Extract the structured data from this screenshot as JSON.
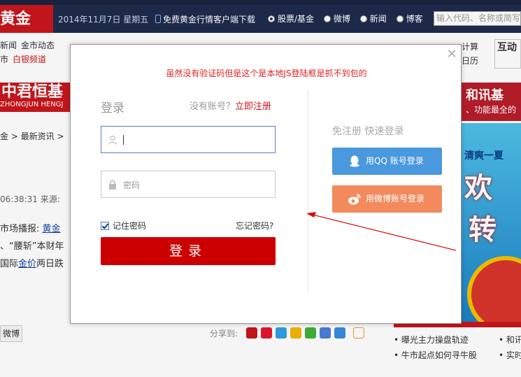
{
  "header": {
    "logo": "黄金",
    "date": "2014年11月7日  星期五",
    "download": "免费黄金行情客户端下载",
    "radios": [
      {
        "label": "股票/基金",
        "selected": true
      },
      {
        "label": "微博",
        "selected": false
      },
      {
        "label": "新闻",
        "selected": false
      },
      {
        "label": "博客",
        "selected": false
      }
    ],
    "search_placeholder": "输入代码、名称或简写"
  },
  "subnav": {
    "row1": [
      "新闻",
      "金市动态"
    ],
    "row2_a": "市",
    "row2_b": "白银频道",
    "right1": "计算",
    "right2": "日历",
    "hudong": "互动"
  },
  "banner_left": {
    "big": "中君恒基",
    "small": "ZHONGJUN HENGJ"
  },
  "banner_right": {
    "big": "和讯基",
    "small": "、功能最全的"
  },
  "ad_right": {
    "t1": "清爽一夏",
    "t2": "欢",
    "t3": "转"
  },
  "article": {
    "breadcrumb": "金 > 最新资讯 >",
    "meta": "06:38:31    来源:",
    "line1_a": "市场播报:",
    "line1_link": "黄金",
    "line2": "、“腰斩”本财年",
    "line3_a": "国际",
    "line3_link": "金价",
    "line3_b": "两日跌"
  },
  "share": {
    "weibo_button": "微博",
    "label": "分享到:"
  },
  "right_list": {
    "items": [
      "• 曝光主力操盘轨迹",
      "• 牛市起点如何寻牛股"
    ],
    "items2": [
      "• 和讯",
      "• 实时"
    ]
  },
  "modal": {
    "notice": "虽然没有验证码但是这个是本地JS登陆框是抓不到包的",
    "login_title": "登录",
    "no_account": "没有账号？",
    "register": "立即注册",
    "username_value": "",
    "password_placeholder": "密码",
    "remember_label": "记住密码",
    "remember_checked": true,
    "forgot": "忘记密码?",
    "login_button": "登录",
    "quick_title": "免注册 快速登录",
    "qq_button": "用QQ 账号登录",
    "weibo_button": "用微博账号登录",
    "colors": {
      "login": "#cc0000",
      "qq": "#4a98dd",
      "weibo": "#f28a5d",
      "notice": "#e02020"
    }
  }
}
